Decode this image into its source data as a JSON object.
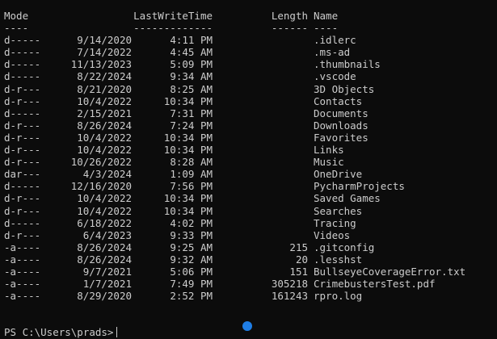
{
  "terminal": {
    "headers": {
      "mode": "Mode",
      "last_write_time": "LastWriteTime",
      "length": "Length",
      "name": "Name"
    },
    "underlines": {
      "mode": "----",
      "last_write_time": "-------------",
      "length": "------",
      "name": "----"
    },
    "rows": [
      {
        "mode": "d-----",
        "date": "9/14/2020",
        "time": "4:11 PM",
        "length": "",
        "name": ".idlerc"
      },
      {
        "mode": "d-----",
        "date": "7/14/2022",
        "time": "4:45 AM",
        "length": "",
        "name": ".ms-ad"
      },
      {
        "mode": "d-----",
        "date": "11/13/2023",
        "time": "5:09 PM",
        "length": "",
        "name": ".thumbnails"
      },
      {
        "mode": "d-----",
        "date": "8/22/2024",
        "time": "9:34 AM",
        "length": "",
        "name": ".vscode"
      },
      {
        "mode": "d-r---",
        "date": "8/21/2020",
        "time": "8:25 AM",
        "length": "",
        "name": "3D Objects"
      },
      {
        "mode": "d-r---",
        "date": "10/4/2022",
        "time": "10:34 PM",
        "length": "",
        "name": "Contacts"
      },
      {
        "mode": "d-----",
        "date": "2/15/2021",
        "time": "7:31 PM",
        "length": "",
        "name": "Documents"
      },
      {
        "mode": "d-r---",
        "date": "8/26/2024",
        "time": "7:24 PM",
        "length": "",
        "name": "Downloads"
      },
      {
        "mode": "d-r---",
        "date": "10/4/2022",
        "time": "10:34 PM",
        "length": "",
        "name": "Favorites"
      },
      {
        "mode": "d-r---",
        "date": "10/4/2022",
        "time": "10:34 PM",
        "length": "",
        "name": "Links"
      },
      {
        "mode": "d-r---",
        "date": "10/26/2022",
        "time": "8:28 AM",
        "length": "",
        "name": "Music"
      },
      {
        "mode": "dar---",
        "date": "4/3/2024",
        "time": "1:09 AM",
        "length": "",
        "name": "OneDrive"
      },
      {
        "mode": "d-----",
        "date": "12/16/2020",
        "time": "7:56 PM",
        "length": "",
        "name": "PycharmProjects"
      },
      {
        "mode": "d-r---",
        "date": "10/4/2022",
        "time": "10:34 PM",
        "length": "",
        "name": "Saved Games"
      },
      {
        "mode": "d-r---",
        "date": "10/4/2022",
        "time": "10:34 PM",
        "length": "",
        "name": "Searches"
      },
      {
        "mode": "d-----",
        "date": "6/18/2022",
        "time": "4:02 PM",
        "length": "",
        "name": "Tracing"
      },
      {
        "mode": "d-r---",
        "date": "6/4/2023",
        "time": "9:33 PM",
        "length": "",
        "name": "Videos"
      },
      {
        "mode": "-a----",
        "date": "8/26/2024",
        "time": "9:25 AM",
        "length": "215",
        "name": ".gitconfig"
      },
      {
        "mode": "-a----",
        "date": "8/26/2024",
        "time": "9:32 AM",
        "length": "20",
        "name": ".lesshst"
      },
      {
        "mode": "-a----",
        "date": "9/7/2021",
        "time": "5:06 PM",
        "length": "151",
        "name": "BullseyeCoverageError.txt"
      },
      {
        "mode": "-a----",
        "date": "1/7/2021",
        "time": "7:49 PM",
        "length": "305218",
        "name": "CrimebustersTest.pdf"
      },
      {
        "mode": "-a----",
        "date": "8/29/2020",
        "time": "2:52 PM",
        "length": "161243",
        "name": "rpro.log"
      }
    ],
    "prompt": "PS C:\\Users\\prads>",
    "colors": {
      "background": "#0c0c0c",
      "foreground": "#cccccc",
      "marker": "#1f7ee6"
    }
  }
}
